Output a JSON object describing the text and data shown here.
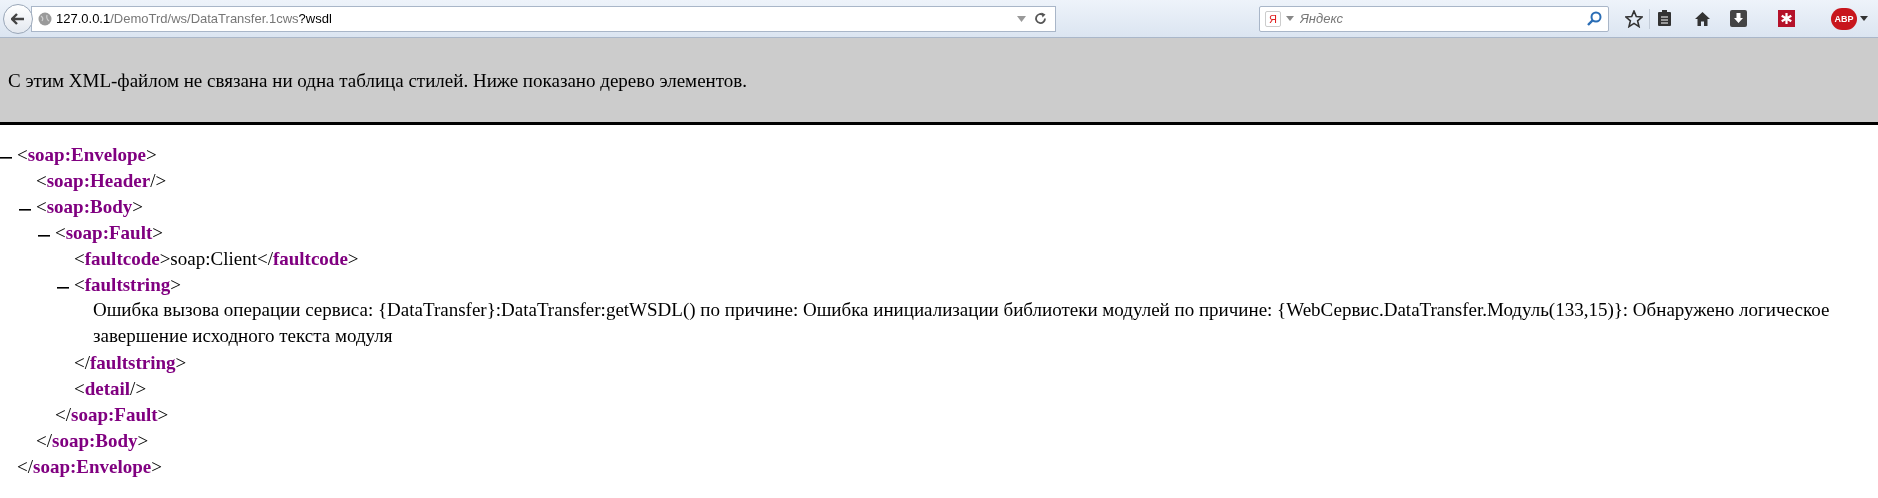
{
  "address_bar": {
    "host": "127.0.0.1",
    "path": "/DemoTrd/ws/DataTransfer.1cws",
    "query": "?wsdl"
  },
  "search": {
    "engine_logo": "Я",
    "placeholder": "Яндекс"
  },
  "addon_badge": "ABP",
  "info_bar": "С этим XML-файлом не связана ни одна таблица стилей. Ниже показано дерево элементов.",
  "tree": [
    {
      "open": "<**soap:Envelope**>",
      "expanded": true,
      "close": "</**soap:Envelope**>",
      "children": [
        {
          "line": "<**soap:Header**/>"
        },
        {
          "open": "<**soap:Body**>",
          "expanded": true,
          "close": "</**soap:Body**>",
          "children": [
            {
              "open": "<**soap:Fault**>",
              "expanded": true,
              "close": "</**soap:Fault**>",
              "children": [
                {
                  "line": "<**faultcode**>soap:Client</**faultcode**>"
                },
                {
                  "open": "<**faultstring**>",
                  "expanded": true,
                  "close": "</**faultstring**>",
                  "text": "Ошибка вызова операции сервиса: {DataTransfer}:DataTransfer:getWSDL() по причине: Ошибка инициализации библиотеки модулей по причине: {WebСервис.DataTransfer.Модуль(133,15)}: Обнаружено логическое завершение исходного текста модуля"
                },
                {
                  "line": "<**detail**/>"
                }
              ]
            }
          ]
        }
      ]
    }
  ]
}
